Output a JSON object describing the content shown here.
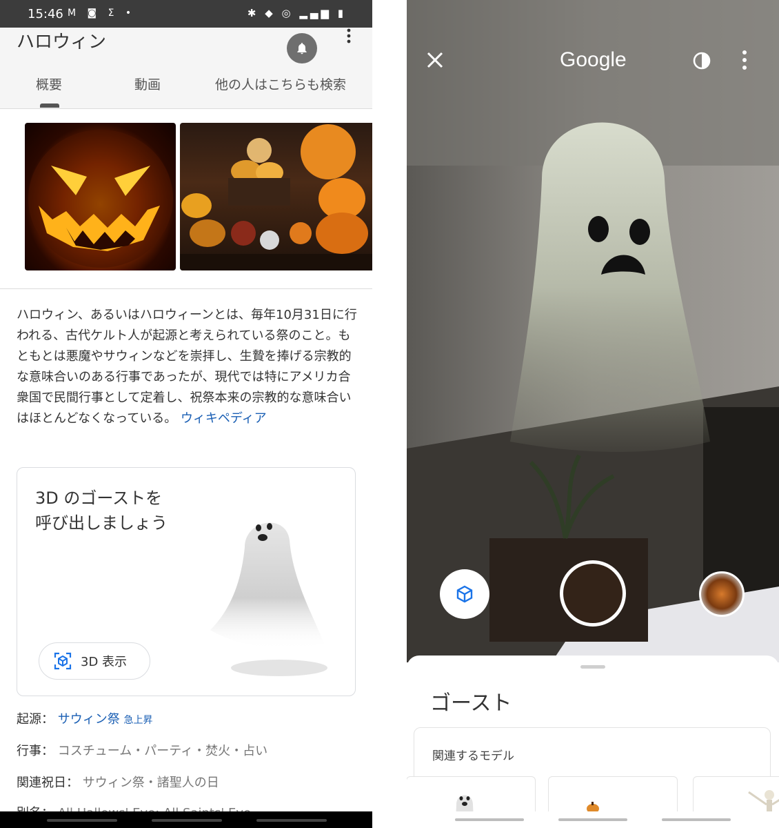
{
  "left": {
    "status": {
      "time": "15:46"
    },
    "header": {
      "title": "ハロウィン",
      "tabs": [
        "概要",
        "動画",
        "他の人はこちらも検索"
      ]
    },
    "description": {
      "text": "ハロウィン、あるいはハロウィーンとは、毎年10月31日に行われる、古代ケルト人が起源と考えられている祭のこと。もともとは悪魔やサウィンなどを崇拝し、生贄を捧げる宗教的な意味合いのある行事であったが、現代では特にアメリカ合衆国で民間行事として定着し、祝祭本来の宗教的な意味合いはほとんどなくなっている。",
      "source_link": "ウィキペディア"
    },
    "card3d": {
      "title_line1": "3D のゴーストを",
      "title_line2": "呼び出しましょう",
      "button_label": "3D 表示"
    },
    "facts": [
      {
        "label": "起源：",
        "value": "サウィン祭",
        "badge": "急上昇"
      },
      {
        "label": "行事：",
        "value": "コスチューム・パーティ・焚火・占い"
      },
      {
        "label": "関連祝日：",
        "value": "サウィン祭・諸聖人の日"
      },
      {
        "label": "別名：",
        "value": "All Hallows' Eve; All Saints' Eve"
      }
    ]
  },
  "right": {
    "header": {
      "brand": "Google"
    },
    "sheet": {
      "title": "ゴースト",
      "related_label": "関連するモデル"
    }
  },
  "colors": {
    "link": "#1a5fb4",
    "statusbar": "#3c3c3c",
    "header_bg": "#f5f5f5"
  },
  "icons": [
    "bell-icon",
    "more-vert-icon",
    "view-in-3d-icon",
    "close-icon",
    "contrast-icon",
    "cube-icon"
  ]
}
